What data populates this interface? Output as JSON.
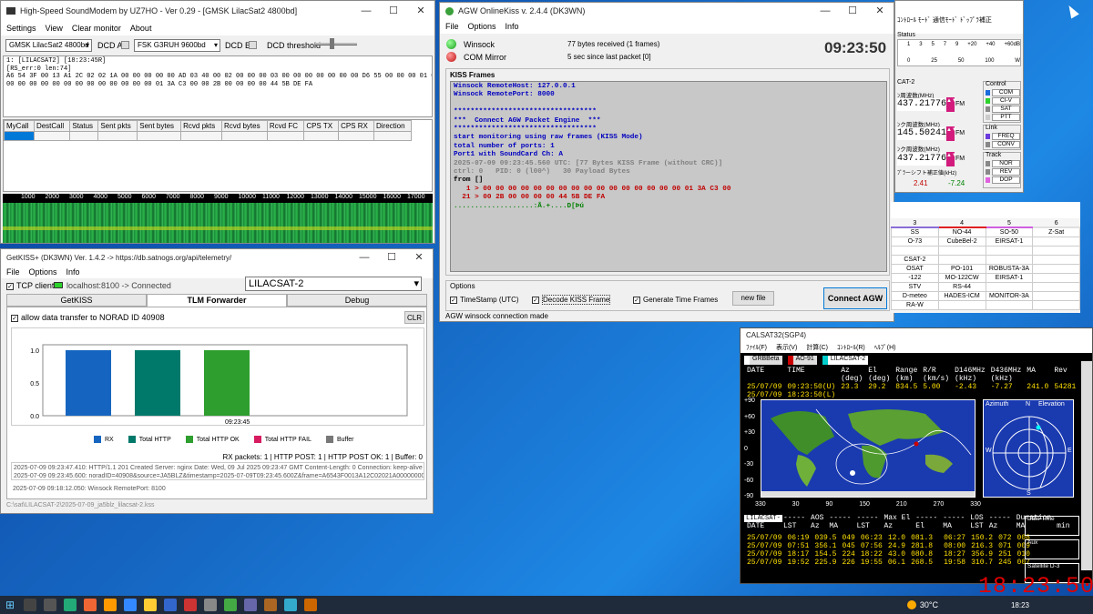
{
  "soundmodem": {
    "title": "High-Speed SoundModem by UZ7HO - Ver 0.29 - [GMSK LilacSat2 4800bd]",
    "menu": [
      "Settings",
      "View",
      "Clear monitor",
      "About"
    ],
    "modem_a": "GMSK LilacSat2 4800bd",
    "dcd_a": "DCD A",
    "modem_b": "FSK G3RUH 9600bd",
    "dcd_b": "DCD B",
    "dcd_threshold": "DCD threshold",
    "monitor_lines": [
      "1: [LILACSAT2] [18:23:45R]",
      "[RS_err:0 len:74]",
      "A6 54 3F 00 13 A1 2C 02 02 1A 00 00 00 00 00 AD 03 40 00 02 00 00 00 03 00 00 00 00 00 00 00 D6 55 00 00 00 01 00 00 00 55 00 00 00 00 00 00",
      "00 00 00 00 00 00 00 00 00 00 00 00 00 01 3A C3 00 00 2B 00 00 00 00 44 5B DE FA"
    ],
    "columns": [
      "MyCall",
      "DestCall",
      "Status",
      "Sent pkts",
      "Sent bytes",
      "Rcvd pkts",
      "Rcvd bytes",
      "Rcvd FC",
      "CPS TX",
      "CPS RX",
      "Direction"
    ],
    "freq_ticks": [
      "1000",
      "2000",
      "3000",
      "4000",
      "5000",
      "6000",
      "7000",
      "8000",
      "9000",
      "10000",
      "11000",
      "12000",
      "13000",
      "14000",
      "15000",
      "16000",
      "17000"
    ]
  },
  "getkiss": {
    "title": "GetKISS+ (DK3WN) Ver. 1.4.2 -> https://db.satnogs.org/api/telemetry/",
    "menu": [
      "File",
      "Options",
      "Info"
    ],
    "tcp_client": "TCP client",
    "connection": "localhost:8100 -> Connected",
    "satellite": "LILACSAT-2",
    "tabs": [
      "GetKISS",
      "TLM Forwarder",
      "Debug"
    ],
    "active_tab": "TLM Forwarder",
    "allow_label": "allow data transfer to NORAD ID 40908",
    "clr": "CLR",
    "y_ticks": [
      "1.0",
      "0.5",
      "0.0"
    ],
    "x_tick": "09:23:45",
    "legend": [
      {
        "name": "RX",
        "color": "#1565c0"
      },
      {
        "name": "Total HTTP",
        "color": "#00796b"
      },
      {
        "name": "Total HTTP OK",
        "color": "#2e9e2e"
      },
      {
        "name": "Total HTTP FAIL",
        "color": "#d81b60"
      },
      {
        "name": "Buffer",
        "color": "#777777"
      }
    ],
    "stats": "RX packets: 1 | HTTP POST: 1 | HTTP POST OK: 1 | Buffer: 0",
    "log": [
      "2025-07-09 09:23:47.410: HTTP/1.1 201 Created Server: nginx Date: Wed, 09 Jul 2025 09:23:47 GMT Content-Length: 0 Connection: keep-alive Vary",
      "2025-07-09 09:23:45.600: noradID=40908&source=JA5BLZ&timestamp=2025-07-09T09:23:45.600Z&frame=A6543F0013A12C02021A00000000AD034"
    ],
    "log2": "2025-07-09 09:18:12.050: Winsock RemotePort: 8100",
    "status": "C:\\sat\\LILACSAT-2\\2025-07-09_ja5blz_lilacsat-2.kss"
  },
  "chart_data": {
    "type": "bar",
    "categories": [
      "RX",
      "Total HTTP",
      "Total HTTP OK",
      "Total HTTP FAIL",
      "Buffer"
    ],
    "values": [
      1,
      1,
      1,
      0,
      0
    ],
    "ylim": [
      0,
      1
    ],
    "xlabel": "09:23:45"
  },
  "agw": {
    "title": "AGW OnlineKiss v. 2.4.4 (DK3WN)",
    "menu": [
      "File",
      "Options",
      "Info"
    ],
    "winsock": "Winsock",
    "winsock_info": "77 bytes received (1 frames)",
    "com": "COM Mirror",
    "com_info": "5 sec since last packet [0]",
    "clock": "09:23:50",
    "kiss_header": "KISS Frames",
    "lines": [
      {
        "t": "Winsock RemoteHost: 127.0.0.1",
        "c": "#0000c0"
      },
      {
        "t": "Winsock RemotePort: 8000",
        "c": "#0000c0"
      },
      {
        "t": "",
        "c": "#000"
      },
      {
        "t": "**********************************",
        "c": "#0000c0"
      },
      {
        "t": "***  Connect AGW Packet Engine  ***",
        "c": "#0000c0"
      },
      {
        "t": "**********************************",
        "c": "#0000c0"
      },
      {
        "t": "start monitoring using raw frames (KISS Mode)",
        "c": "#0000c0"
      },
      {
        "t": "total number of ports: 1",
        "c": "#0000c0"
      },
      {
        "t": "Port1 with SoundCard Ch: A",
        "c": "#0000c0"
      },
      {
        "t": "2025-07-09 09:23:45.560 UTC: [77 Bytes KISS Frame (without CRC)]",
        "c": "#808080"
      },
      {
        "t": "ctrl: 0   PID: 0 (l00^)   30 Payload Bytes",
        "c": "#808080"
      },
      {
        "t": "from []",
        "c": "#000"
      },
      {
        "t": "   1 > 00 00 00 00 00 00 00 00 00 00 00 00 00 00 00 00 01 3A C3 00",
        "c": "#c00000"
      },
      {
        "t": "  21 > 00 2B 00 00 00 00 44 5B DE FA",
        "c": "#c00000"
      },
      {
        "t": "...................:Ã.+....D[Þú",
        "c": "#008000"
      }
    ],
    "options_label": "Options",
    "timestamp": "TimeStamp (UTC)",
    "decode": "Decode KISS Frame",
    "generate": "Generate Time Frames",
    "newfile": "new file",
    "connect": "Connect AGW",
    "status": "AGW winsock connection made"
  },
  "rig": {
    "title": "ｺﾝﾄﾛｰﾙ ﾓｰﾄﾞ  通信ﾓｰﾄﾞ  ﾄﾞｯﾌﾟﾗ補正",
    "status_label": "Status",
    "scale": [
      "1",
      "3",
      "5",
      "7",
      "9",
      "+20",
      "+40",
      "+60dB"
    ],
    "scale2": [
      "0",
      "25",
      "50",
      "100",
      "W"
    ],
    "panel": "CAT-2",
    "dl_label": "ﾝ周波数(MHz)",
    "dl_freq": "437.21776",
    "mode1": "FM",
    "up_label": "ﾝク周波数(MHz)",
    "up_freq": "145.50241",
    "mode2": "FM",
    "dl2_label": "ﾝク周波数(MHz)",
    "dl2_freq": "437.21776",
    "mode3": "FM",
    "doppler_label": "ﾌﾟﾗーシフト補正値(kHz)",
    "dop_a": "2.41",
    "dop_b": "-7.24",
    "control": "Control",
    "ctl_items": [
      "COM",
      "CI-V",
      "SAT",
      "PTT"
    ],
    "link": "Link",
    "link_items": [
      "FREQ",
      "CONV"
    ],
    "track": "Track",
    "track_items": [
      "NOR",
      "REV",
      "DOP"
    ]
  },
  "satlist": {
    "headers": [
      "3",
      "4",
      "5",
      "6"
    ],
    "rows": [
      [
        "SS",
        "NO-44",
        "SO-50",
        "Z-Sat"
      ],
      [
        "O-73",
        "CubeBel-2",
        "EIRSAT-1",
        ""
      ],
      [
        "",
        "",
        "",
        ""
      ],
      [
        "CSAT-2",
        "",
        "",
        ""
      ],
      [
        "OSAT",
        "PO-101",
        "ROBUSTA-3A",
        ""
      ],
      [
        "-122",
        "MO-122CW",
        "EIRSAT-1",
        ""
      ],
      [
        "STV",
        "RS-44",
        "",
        ""
      ],
      [
        "D-meteo",
        "HADES-ICM",
        "MONITOR-3A",
        ""
      ],
      [
        "RA-W",
        "",
        "",
        ""
      ]
    ]
  },
  "calsat": {
    "title": "CALSAT32(SGP4)",
    "menu": [
      "ﾌｧｲﾙ(F)",
      "表示(V)",
      "計算(C)",
      "ｺﾝﾄﾛｰﾙ(R)",
      "ﾍﾙﾌﾟ(H)"
    ],
    "sats": [
      "GRBBeta",
      "AO-91",
      "LILACSAT-2"
    ],
    "head": [
      "DATE",
      "TIME",
      "Az",
      "El",
      "Range",
      "R/R",
      "D146MHz",
      "D436MHz",
      "MA",
      "Rev"
    ],
    "units": [
      "",
      "",
      "(deg)",
      "(deg)",
      "(km)",
      "(km/s)",
      "(kHz)",
      "(kHz)",
      "",
      ""
    ],
    "row1": [
      "25/07/09",
      "09:23:50(U)",
      "23.3",
      "29.2",
      "834.5",
      "5.00",
      "-2.43",
      "-7.27",
      "241.0",
      "54281"
    ],
    "row2": [
      "25/07/09",
      "18:23:50(L)",
      "",
      "",
      "",
      "",
      "",
      "",
      "",
      ""
    ],
    "map_y": [
      "+90",
      "+60",
      "+30",
      "0",
      "-30",
      "-60",
      "-90"
    ],
    "map_x": [
      "330",
      "30",
      "90",
      "150",
      "210",
      "270",
      "330"
    ],
    "azimuth": "Azimuth",
    "north": "N",
    "elevation": "Elevation",
    "east": "E",
    "west": "W",
    "south": "S",
    "pass_title": "LILACSAT-",
    "pass_head1": [
      "-----",
      "AOS",
      "-----",
      "-----",
      "Max El",
      "-----",
      "-----",
      "LOS",
      "-----",
      "Duration"
    ],
    "pass_head2": [
      "DATE",
      "LST",
      "Az",
      "MA",
      "LST",
      "Az",
      "El",
      "MA",
      "LST",
      "Az",
      "MA",
      "min"
    ],
    "passes": [
      [
        "25/07/09",
        "06:19",
        "039.5",
        "049",
        "06:23",
        "12.0",
        "081.3",
        "",
        "06:27",
        "150.2",
        "072",
        "008"
      ],
      [
        "25/07/09",
        "07:51",
        "356.1",
        "045",
        "07:56",
        "24.9",
        "281.8",
        "",
        "08:00",
        "216.3",
        "071",
        "009"
      ],
      [
        "25/07/09",
        "18:17",
        "154.5",
        "224",
        "18:22",
        "43.0",
        "080.8",
        "",
        "18:27",
        "356.9",
        "251",
        "010"
      ],
      [
        "25/07/09",
        "19:52",
        "225.9",
        "226",
        "19:55",
        "06.1",
        "268.5",
        "",
        "19:58",
        "310.7",
        "245",
        "007"
      ]
    ],
    "big_clock": "18:23:50",
    "side": [
      "Date Time",
      "Aux",
      "Satellite D-3"
    ]
  },
  "taskbar": {
    "temp": "30°C",
    "time": "18:23"
  }
}
